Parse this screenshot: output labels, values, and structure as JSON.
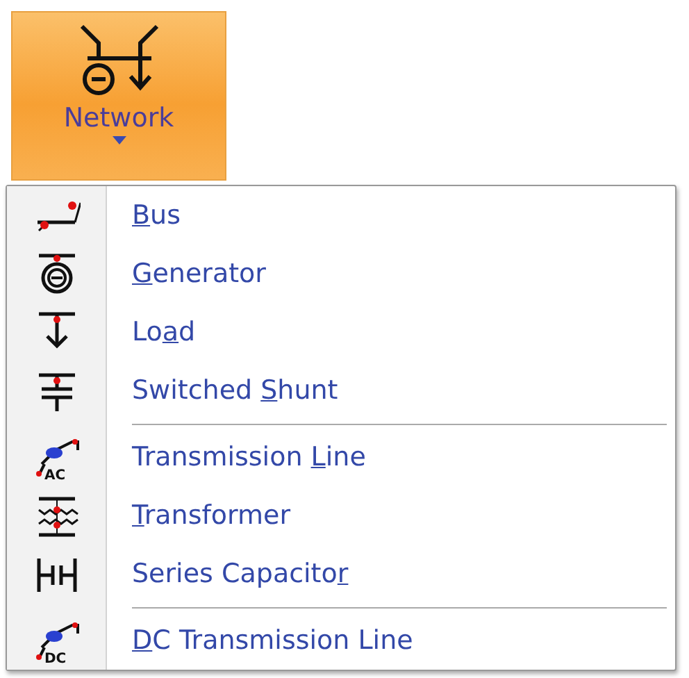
{
  "ribbon_button": {
    "label": "Network",
    "expanded": true
  },
  "menu": {
    "groups": [
      {
        "items": [
          {
            "kind": "bus",
            "key": "B",
            "after": "us"
          },
          {
            "kind": "generator",
            "key": "G",
            "after": "enerator"
          },
          {
            "kind": "load",
            "before": "Lo",
            "key": "a",
            "after": "d"
          },
          {
            "kind": "shunt",
            "before": "Switched ",
            "key": "S",
            "after": "hunt"
          }
        ]
      },
      {
        "items": [
          {
            "kind": "line",
            "icon_text": "AC",
            "before": "Transmission ",
            "key": "L",
            "after": "ine"
          },
          {
            "kind": "transformer",
            "key": "T",
            "after": "ransformer"
          },
          {
            "kind": "capacitor",
            "before": "Series Capacito",
            "key": "r"
          }
        ]
      },
      {
        "items": [
          {
            "kind": "line",
            "icon_text": "DC",
            "key": "D",
            "after": "C Transmission Line"
          }
        ]
      }
    ]
  }
}
